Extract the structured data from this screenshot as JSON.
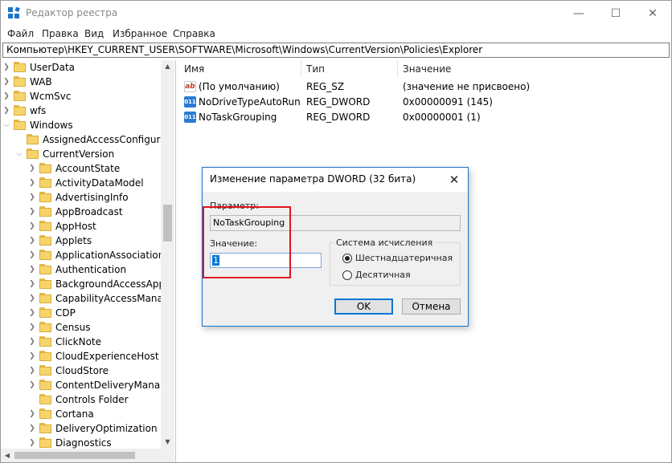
{
  "window": {
    "title": "Редактор реестра",
    "controls": {
      "minimize": "—",
      "maximize": "☐",
      "close": "✕"
    }
  },
  "menu": [
    "Файл",
    "Правка",
    "Вид",
    "Избранное",
    "Справка"
  ],
  "address": "Компьютер\\HKEY_CURRENT_USER\\SOFTWARE\\Microsoft\\Windows\\CurrentVersion\\Policies\\Explorer",
  "tree": [
    "UserData",
    "WAB",
    "WcmSvc",
    "wfs",
    "Windows",
    "AssignedAccessConfiguration",
    "CurrentVersion",
    "AccountState",
    "ActivityDataModel",
    "AdvertisingInfo",
    "AppBroadcast",
    "AppHost",
    "Applets",
    "ApplicationAssociationToasts",
    "Authentication",
    "BackgroundAccessApplications",
    "CapabilityAccessManager",
    "CDP",
    "Census",
    "ClickNote",
    "CloudExperienceHost",
    "CloudStore",
    "ContentDeliveryManager",
    "Controls Folder",
    "Cortana",
    "DeliveryOptimization",
    "Diagnostics"
  ],
  "list": {
    "headers": {
      "name": "Имя",
      "type": "Тип",
      "value": "Значение"
    },
    "rows": [
      {
        "icon": "ab",
        "name": "(По умолчанию)",
        "type": "REG_SZ",
        "value": "(значение не присвоено)"
      },
      {
        "icon": "011",
        "name": "NoDriveTypeAutoRun",
        "type": "REG_DWORD",
        "value": "0x00000091 (145)"
      },
      {
        "icon": "011",
        "name": "NoTaskGrouping",
        "type": "REG_DWORD",
        "value": "0x00000001 (1)"
      }
    ]
  },
  "dialog": {
    "title": "Изменение параметра DWORD (32 бита)",
    "close": "✕",
    "param_label": "Параметр:",
    "param_value": "NoTaskGrouping",
    "value_label": "Значение:",
    "value": "1",
    "radix_title": "Система исчисления",
    "radix_hex": "Шестнадцатеричная",
    "radix_dec": "Десятичная",
    "selected_radix": "hex",
    "ok": "OK",
    "cancel": "Отмена"
  },
  "scroll": {
    "up": "▲",
    "down": "▼",
    "left": "◀"
  },
  "colors": {
    "accent": "#0078d7",
    "highlight_box": "#e0141e",
    "folder": "#f7d46b"
  }
}
